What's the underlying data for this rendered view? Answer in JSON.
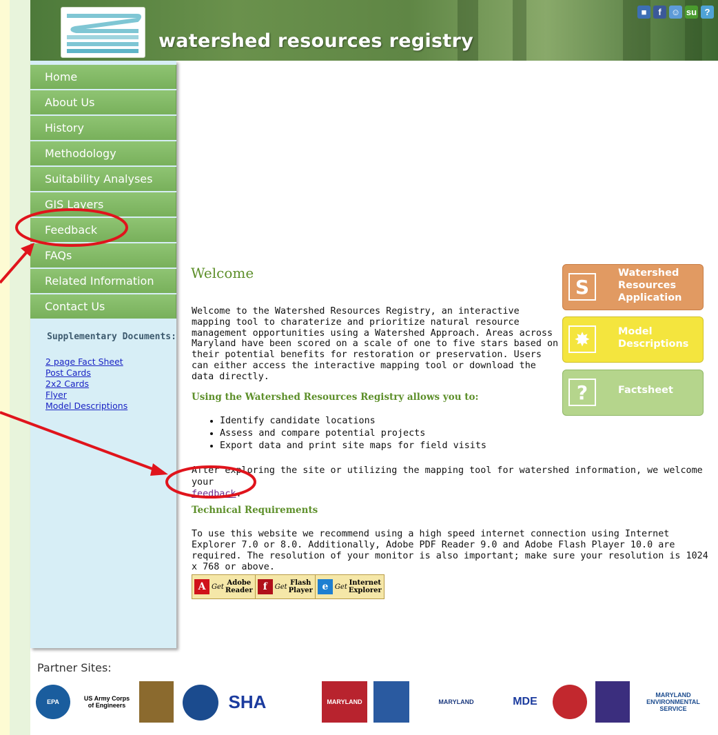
{
  "site": {
    "title": "watershed resources registry"
  },
  "social": [
    {
      "name": "delicious-icon",
      "glyph": "■",
      "color": "#3d6fb5"
    },
    {
      "name": "facebook-icon",
      "glyph": "f",
      "color": "#3b5998"
    },
    {
      "name": "reddit-icon",
      "glyph": "☺",
      "color": "#5d9bd8"
    },
    {
      "name": "stumbleupon-icon",
      "glyph": "su",
      "color": "#4a9b2e"
    },
    {
      "name": "help-icon",
      "glyph": "?",
      "color": "#4fa3d6"
    }
  ],
  "nav": [
    {
      "label": "Home"
    },
    {
      "label": "About Us"
    },
    {
      "label": "History"
    },
    {
      "label": "Methodology"
    },
    {
      "label": "Suitability Analyses"
    },
    {
      "label": "GIS Layers"
    },
    {
      "label": "Feedback"
    },
    {
      "label": "FAQs"
    },
    {
      "label": "Related Information"
    },
    {
      "label": "Contact Us"
    }
  ],
  "supplementary": {
    "title": "Supplementary Documents:",
    "links": [
      "2 page Fact Sheet",
      "Post Cards",
      "2x2 Cards",
      "Flyer",
      "Model Descriptions"
    ]
  },
  "main": {
    "welcome": "Welcome",
    "intro": "Welcome to the Watershed Resources Registry, an interactive mapping tool to charaterize and prioritize natural resource management opportunities using a Watershed Approach. Areas across Maryland have been scored on a scale of one to five stars based on their potential benefits for restoration or preservation. Users can either access the interactive mapping tool or download the data directly.",
    "using_heading": "Using the Watershed Resources Registry allows you to:",
    "bullets": [
      "Identify candidate locations",
      "Assess and compare potential projects",
      "Export data and print site maps for field visits"
    ],
    "after_text": "After exploring the site or utilizing the mapping tool for watershed information, we welcome your",
    "feedback_link": "feedback",
    "after_end": ".",
    "tech_heading": "Technical Requirements",
    "tech_text": "To use this website we recommend using a high speed internet connection using Internet Explorer 7.0 or 8.0. Additionally, Adobe PDF Reader 9.0 and Adobe Flash Player 10.0 are required. The resolution of your monitor is also important; make sure your resolution is 1024 x 768 or above.",
    "getters": [
      {
        "get": "Get",
        "line1": "Adobe",
        "line2": "Reader",
        "color": "#d0121b",
        "glyph": "A"
      },
      {
        "get": "Get",
        "line1": "Flash",
        "line2": "Player",
        "color": "#b0101a",
        "glyph": "f"
      },
      {
        "get": "Get",
        "line1": "Internet",
        "line2": "Explorer",
        "color": "#1d7fd1",
        "glyph": "e"
      }
    ]
  },
  "app_buttons": [
    {
      "label": "Watershed Resources Application",
      "lines": [
        "Watershed",
        "Resources",
        "Application"
      ],
      "bg": "#e19a62",
      "border": "#c87d45",
      "glyph": "S"
    },
    {
      "label": "Model Descriptions",
      "lines": [
        "Model",
        "Descriptions"
      ],
      "bg": "#f4e53e",
      "border": "#cfc02a",
      "glyph": "✸"
    },
    {
      "label": "Factsheet",
      "lines": [
        "Factsheet"
      ],
      "bg": "#b5d58c",
      "border": "#8fb766",
      "glyph": "?"
    }
  ],
  "partners": {
    "title": "Partner Sites:",
    "logos": [
      {
        "name": "epa-logo",
        "text": "EPA"
      },
      {
        "name": "us-army-corps-logo",
        "text": "US Army Corps of Engineers"
      },
      {
        "name": "fish-wildlife-logo",
        "text": ""
      },
      {
        "name": "dot-logo",
        "text": ""
      },
      {
        "name": "sha-logo",
        "text": "SHA"
      },
      {
        "name": "green-logo",
        "text": ""
      },
      {
        "name": "maryland-dot-logo",
        "text": "MARYLAND"
      },
      {
        "name": "state-seal-logo",
        "text": ""
      },
      {
        "name": "maryland-dnr-logo",
        "text": "MARYLAND"
      },
      {
        "name": "mde-logo",
        "text": "MDE"
      },
      {
        "name": "maryland-seal-logo",
        "text": ""
      },
      {
        "name": "prince-georges-logo",
        "text": ""
      },
      {
        "name": "maryland-env-service-logo",
        "text": "MARYLAND ENVIRONMENTAL SERVICE"
      }
    ]
  }
}
